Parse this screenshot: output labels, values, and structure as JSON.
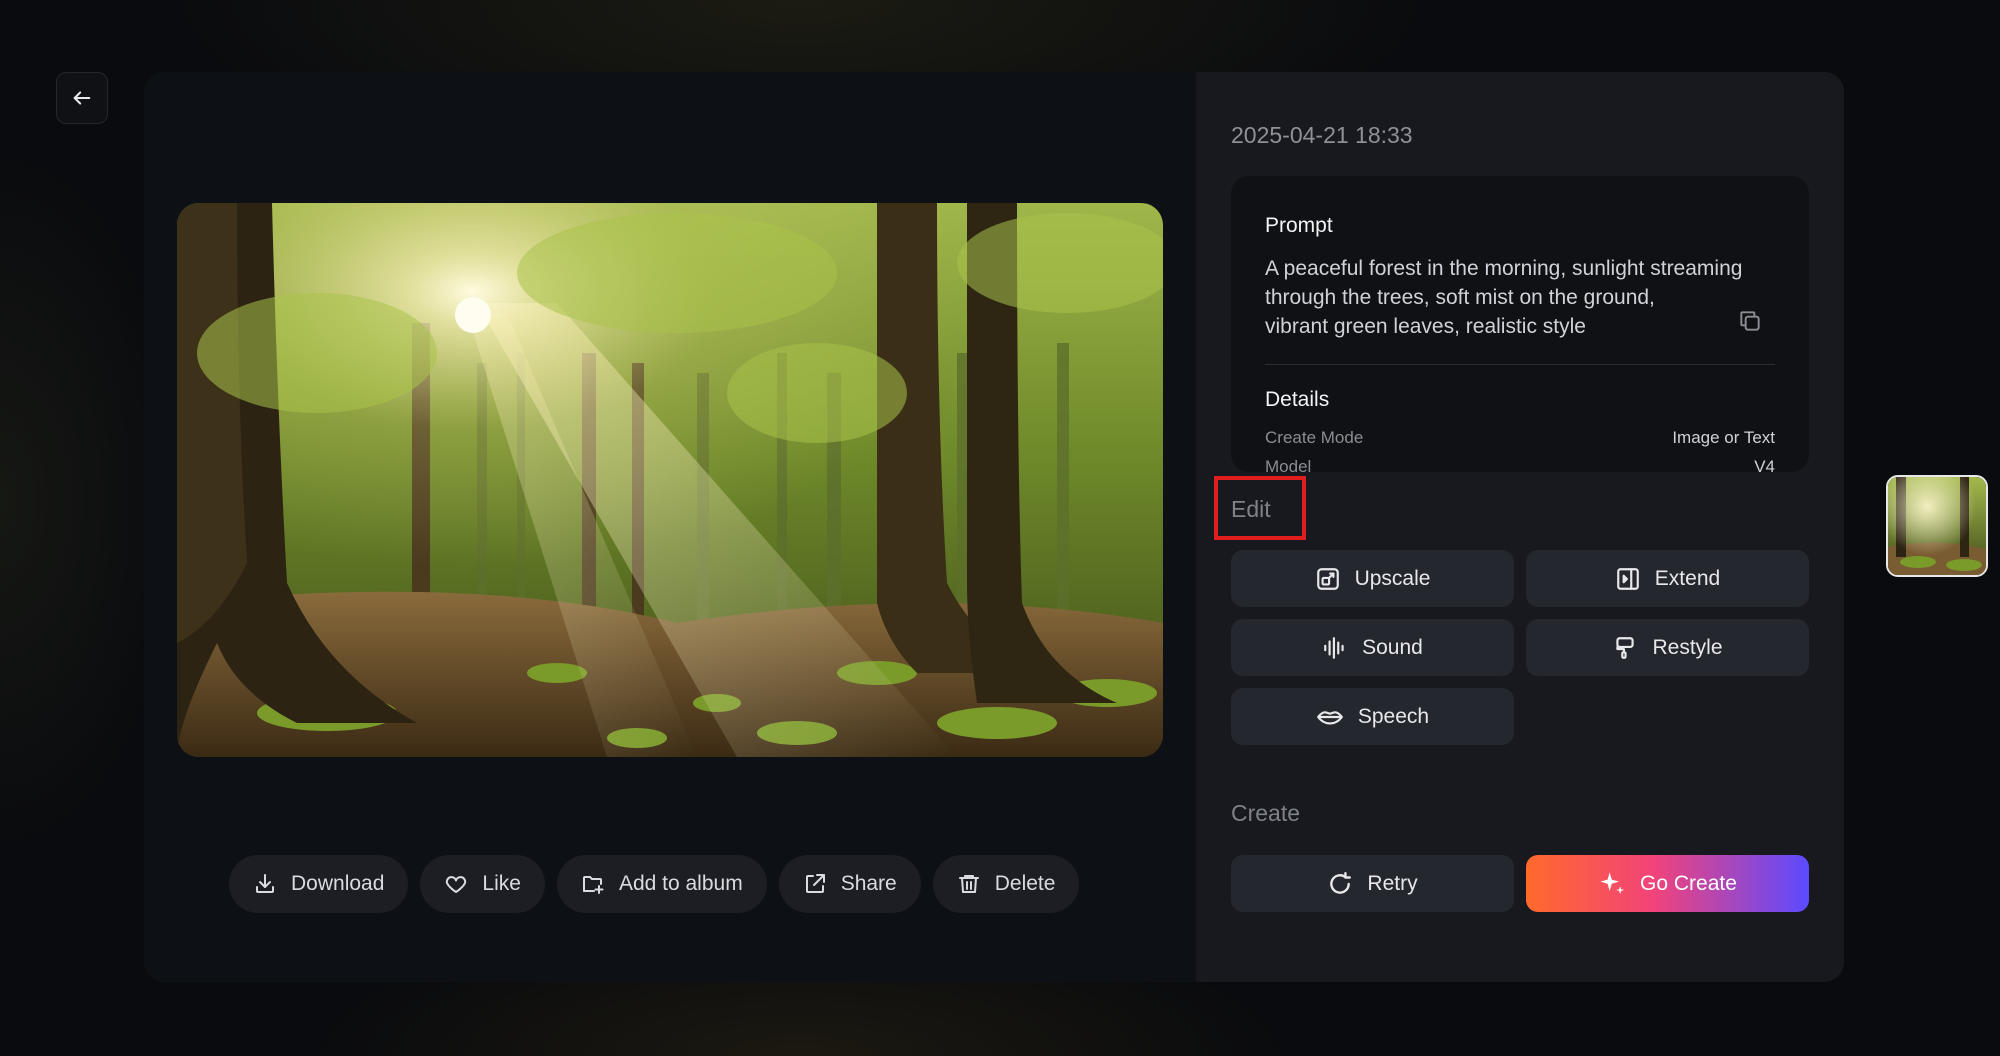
{
  "header": {
    "back_icon": "arrow-left-icon"
  },
  "viewer": {
    "image_alt": "forest image",
    "actions": [
      {
        "label": "Download",
        "icon": "download-icon"
      },
      {
        "label": "Like",
        "icon": "heart-icon"
      },
      {
        "label": "Add to album",
        "icon": "folder-add-icon"
      },
      {
        "label": "Share",
        "icon": "share-icon"
      },
      {
        "label": "Delete",
        "icon": "trash-icon"
      }
    ]
  },
  "side": {
    "timestamp": "2025-04-21 18:33",
    "prompt": {
      "heading": "Prompt",
      "lines": [
        "A peaceful forest in the morning, sunlight streaming",
        "through the trees, soft mist on the ground,",
        "vibrant green leaves, realistic style"
      ],
      "copy_icon": "copy-icon"
    },
    "details": {
      "heading": "Details",
      "rows": [
        {
          "key": "Create Mode",
          "value": "Image or Text"
        },
        {
          "key": "Model",
          "value": "V4"
        }
      ]
    },
    "edit": {
      "title": "Edit",
      "tools": [
        {
          "label": "Upscale",
          "icon": "upscale-icon"
        },
        {
          "label": "Extend",
          "icon": "extend-icon"
        },
        {
          "label": "Sound",
          "icon": "sound-wave-icon"
        },
        {
          "label": "Restyle",
          "icon": "paint-brush-icon"
        },
        {
          "label": "Speech",
          "icon": "lips-icon"
        }
      ]
    },
    "create": {
      "title": "Create",
      "retry_label": "Retry",
      "go_create_label": "Go Create"
    }
  },
  "colors": {
    "highlight": "#e11d1d",
    "gradient_start": "#ff6a2b",
    "gradient_end": "#5b4bff"
  }
}
